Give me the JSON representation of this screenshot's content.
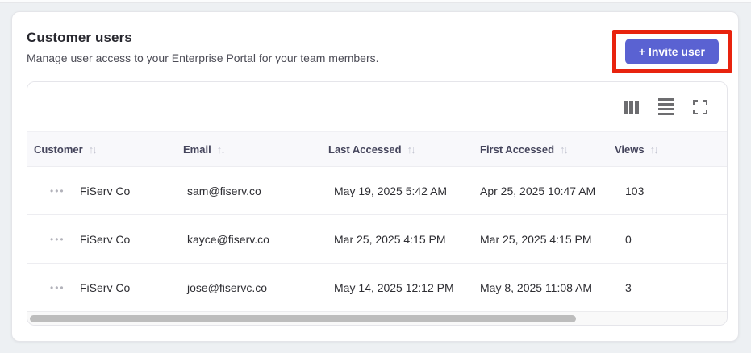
{
  "page": {
    "background": "#edf0f3"
  },
  "header": {
    "title": "Customer users",
    "subtitle": "Manage user access to your Enterprise Portal for your team members.",
    "invite_button_label": "+ Invite user",
    "invite_button_color": "#5a62d2",
    "annotation_highlight_color": "#e8230e"
  },
  "toolbar": {
    "icons": [
      "columns-icon",
      "row-density-icon",
      "fullscreen-icon"
    ]
  },
  "table": {
    "sort_icon": "↑↓",
    "row_menu_icon": "•••",
    "columns": [
      {
        "label": "Customer",
        "sortable": true
      },
      {
        "label": "Email",
        "sortable": true
      },
      {
        "label": "Last Accessed",
        "sortable": true
      },
      {
        "label": "First Accessed",
        "sortable": true
      },
      {
        "label": "Views",
        "sortable": true
      }
    ],
    "rows": [
      {
        "customer": "FiServ Co",
        "email": "sam@fiserv.co",
        "last_accessed": "May 19, 2025 5:42 AM",
        "first_accessed": "Apr 25, 2025 10:47 AM",
        "views": "103"
      },
      {
        "customer": "FiServ Co",
        "email": "kayce@fiserv.co",
        "last_accessed": "Mar 25, 2025 4:15 PM",
        "first_accessed": "Mar 25, 2025 4:15 PM",
        "views": "0"
      },
      {
        "customer": "FiServ Co",
        "email": "jose@fiservc.co",
        "last_accessed": "May 14, 2025 12:12 PM",
        "first_accessed": "May 8, 2025 11:08 AM",
        "views": "3"
      }
    ]
  }
}
